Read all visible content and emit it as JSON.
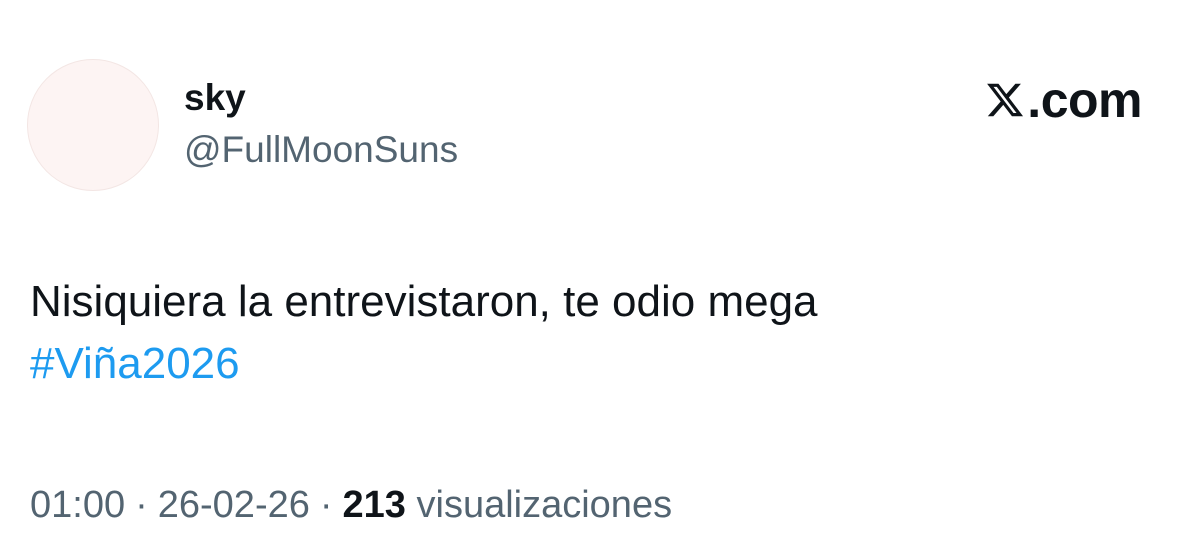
{
  "author": {
    "display_name": "sky",
    "handle": "@FullMoonSuns"
  },
  "brand": {
    "logo_icon": "x-logo-icon",
    "text": ".com"
  },
  "tweet": {
    "text_line1": "Nisiquiera la entrevistaron, te odio mega",
    "hashtag": "#Viña2026"
  },
  "meta": {
    "time": "01:00",
    "separator": "·",
    "date": "26-02-26",
    "views_count": "213",
    "views_label": "visualizaciones"
  },
  "colors": {
    "text": "#0f1419",
    "secondary": "#536471",
    "link": "#1d9bf0",
    "avatar": "#fdf4f3"
  }
}
